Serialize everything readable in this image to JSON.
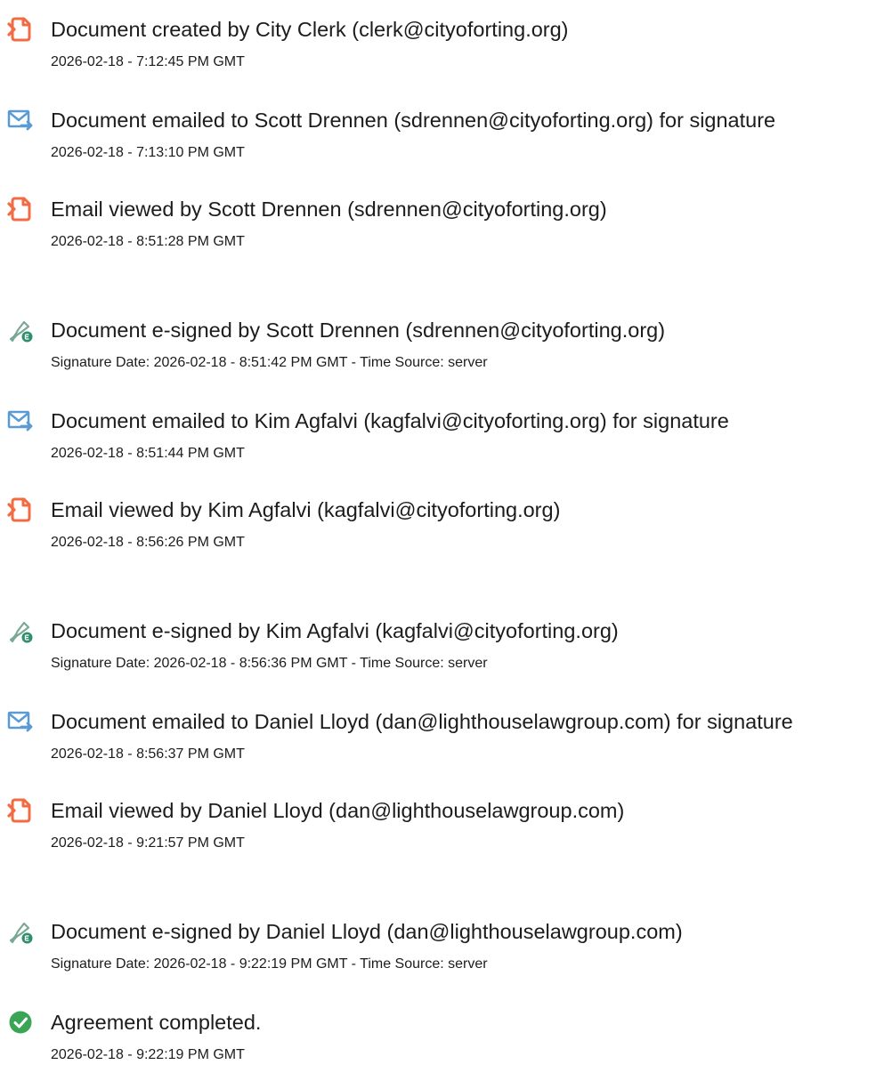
{
  "events": [
    {
      "type": "created",
      "icon": "document-created-icon",
      "title": "Document created by City Clerk (clerk@cityoforting.org)",
      "meta": "2026-02-18 - 7:12:45 PM GMT"
    },
    {
      "type": "emailed",
      "icon": "email-sent-icon",
      "title": "Document emailed to Scott Drennen (sdrennen@cityoforting.org) for signature",
      "meta": "2026-02-18 - 7:13:10 PM GMT"
    },
    {
      "type": "viewed",
      "icon": "document-viewed-icon",
      "title": "Email viewed by Scott Drennen (sdrennen@cityoforting.org)",
      "meta": "2026-02-18 - 8:51:28 PM GMT"
    },
    {
      "type": "signed",
      "icon": "e-sign-pen-icon",
      "title": "Document e-signed by Scott Drennen (sdrennen@cityoforting.org)",
      "meta": "Signature Date: 2026-02-18 - 8:51:42 PM GMT - Time Source: server"
    },
    {
      "type": "emailed",
      "icon": "email-sent-icon",
      "title": "Document emailed to Kim Agfalvi (kagfalvi@cityoforting.org) for signature",
      "meta": "2026-02-18 - 8:51:44 PM GMT"
    },
    {
      "type": "viewed",
      "icon": "document-viewed-icon",
      "title": "Email viewed by Kim Agfalvi (kagfalvi@cityoforting.org)",
      "meta": "2026-02-18 - 8:56:26 PM GMT"
    },
    {
      "type": "signed",
      "icon": "e-sign-pen-icon",
      "title": "Document e-signed by Kim Agfalvi (kagfalvi@cityoforting.org)",
      "meta": "Signature Date: 2026-02-18 - 8:56:36 PM GMT - Time Source: server"
    },
    {
      "type": "emailed",
      "icon": "email-sent-icon",
      "title": "Document emailed to Daniel Lloyd (dan@lighthouselawgroup.com) for signature",
      "meta": "2026-02-18 - 8:56:37 PM GMT"
    },
    {
      "type": "viewed",
      "icon": "document-viewed-icon",
      "title": "Email viewed by Daniel Lloyd (dan@lighthouselawgroup.com)",
      "meta": "2026-02-18 - 9:21:57 PM GMT"
    },
    {
      "type": "signed",
      "icon": "e-sign-pen-icon",
      "title": "Document e-signed by Daniel Lloyd (dan@lighthouselawgroup.com)",
      "meta": "Signature Date: 2026-02-18 - 9:22:19 PM GMT - Time Source: server"
    },
    {
      "type": "completed",
      "icon": "check-circle-icon",
      "title": "Agreement completed.",
      "meta": "2026-02-18 - 9:22:19 PM GMT"
    }
  ],
  "colors": {
    "document_icon": "#f26b43",
    "email_icon": "#5b9bd5",
    "sign_icon": "#4b9b7a",
    "check_icon": "#3aa655",
    "text": "#1c1c1c"
  }
}
